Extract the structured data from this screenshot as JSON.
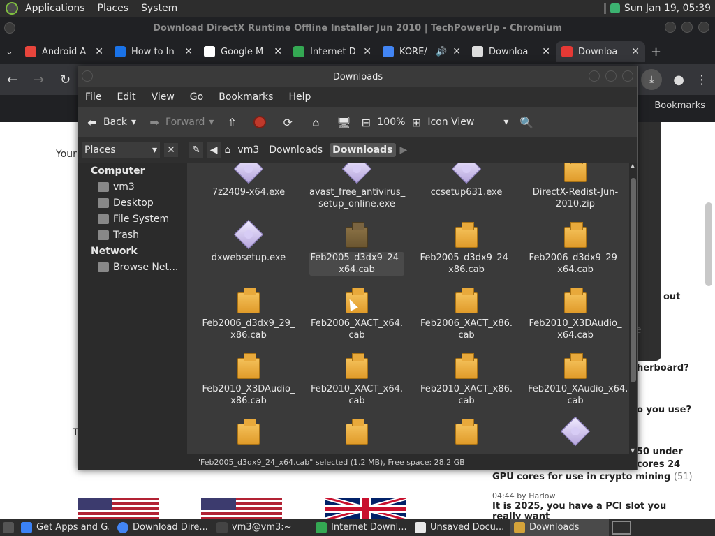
{
  "topbar": {
    "applications": "Applications",
    "places": "Places",
    "system": "System",
    "datetime": "Sun Jan 19, 05:39"
  },
  "chrome": {
    "window_title": "Download DirectX Runtime Offline Installer Jun 2010 | TechPowerUp - Chromium",
    "tabs": [
      {
        "label": "Android A",
        "color": "#e8453c"
      },
      {
        "label": "How to In",
        "color": "#1a73e8"
      },
      {
        "label": "Google M",
        "color": "#ffffff"
      },
      {
        "label": "Internet D",
        "color": "#34a853"
      },
      {
        "label": "KORE/",
        "color": "#4285f4"
      },
      {
        "label": "Downloa",
        "color": "#dddddd"
      },
      {
        "label": "Downloa",
        "color": "#e53935"
      }
    ],
    "bookmarks": "Bookmarks"
  },
  "web": {
    "left_text_1": "Your",
    "left_text_2": "T",
    "side_snippets": [
      {
        "text": "out"
      },
      {
        "text": "e"
      },
      {
        "text": "herboard?"
      },
      {
        "text": "o you use?"
      }
    ],
    "headline_3_part1": "50 under",
    "headline_3_part2": "cores 24",
    "headline_3_line3": "GPU cores for use in crypto mining",
    "headline_3_count": "(51)",
    "meta_time": "04:44",
    "meta_by": "by",
    "meta_author": "Harlow",
    "headline_4": "It is 2025, you have a PCI slot you really want"
  },
  "file_manager": {
    "title": "Downloads",
    "menu": [
      "File",
      "Edit",
      "View",
      "Go",
      "Bookmarks",
      "Help"
    ],
    "toolbar": {
      "back": "Back",
      "forward": "Forward",
      "zoom": "100%",
      "view_mode": "Icon View"
    },
    "places_label": "Places",
    "breadcrumbs": [
      "vm3",
      "Downloads",
      "Downloads"
    ],
    "sidebar": {
      "computer_header": "Computer",
      "computer_items": [
        "vm3",
        "Desktop",
        "File System",
        "Trash"
      ],
      "network_header": "Network",
      "network_items": [
        "Browse Net..."
      ]
    },
    "files": [
      {
        "name": "7z2409-x64.exe",
        "type": "exe"
      },
      {
        "name": "avast_free_antivirus_ setup_online.exe",
        "type": "exe"
      },
      {
        "name": "ccsetup631.exe",
        "type": "exe"
      },
      {
        "name": "DirectX-Redist-Jun- 2010.zip",
        "type": "box"
      },
      {
        "name": "dxwebsetup.exe",
        "type": "exe"
      },
      {
        "name": "Feb2005_d3dx9_24_ x64.cab",
        "type": "box-dark",
        "selected": true
      },
      {
        "name": "Feb2005_d3dx9_24_ x86.cab",
        "type": "box"
      },
      {
        "name": "Feb2006_d3dx9_29_ x64.cab",
        "type": "box"
      },
      {
        "name": "Feb2006_d3dx9_29_ x86.cab",
        "type": "box"
      },
      {
        "name": "Feb2006_XACT_x64. cab",
        "type": "box"
      },
      {
        "name": "Feb2006_XACT_x86. cab",
        "type": "box"
      },
      {
        "name": "Feb2010_X3DAudio_ x64.cab",
        "type": "box"
      },
      {
        "name": "Feb2010_X3DAudio_ x86.cab",
        "type": "box"
      },
      {
        "name": "Feb2010_XACT_x64. cab",
        "type": "box"
      },
      {
        "name": "Feb2010_XACT_x86. cab",
        "type": "box"
      },
      {
        "name": "Feb2010_XAudio_x64. cab",
        "type": "box"
      },
      {
        "name": "",
        "type": "box"
      },
      {
        "name": "",
        "type": "box"
      },
      {
        "name": "",
        "type": "box"
      },
      {
        "name": "",
        "type": "exe"
      }
    ],
    "status": "\"Feb2005_d3dx9_24_x64.cab\" selected (1.2 MB), Free space: 28.2 GB"
  },
  "taskbar": {
    "items": [
      {
        "label": "Get Apps and G...",
        "color": "#3b82f6"
      },
      {
        "label": "Download Dire...",
        "color": "#4285f4"
      },
      {
        "label": "vm3@vm3:~",
        "color": "#444444"
      },
      {
        "label": "Internet Downl...",
        "color": "#34a853"
      },
      {
        "label": "Unsaved Docu...",
        "color": "#e9e9e9"
      },
      {
        "label": "Downloads",
        "color": "#d4a33a",
        "active": true
      }
    ]
  }
}
